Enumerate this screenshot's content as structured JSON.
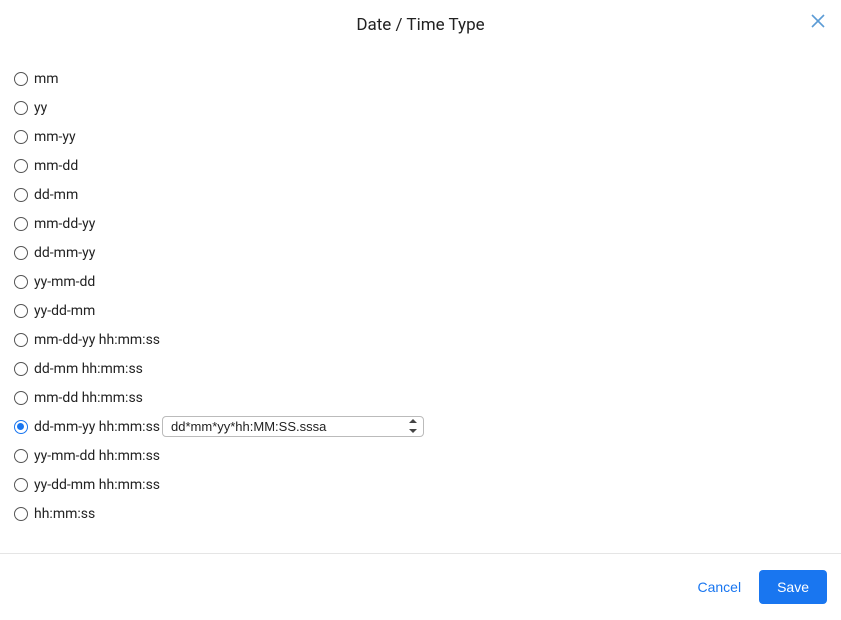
{
  "header": {
    "title": "Date / Time Type"
  },
  "options": [
    {
      "label": "mm",
      "checked": false
    },
    {
      "label": "yy",
      "checked": false
    },
    {
      "label": "mm-yy",
      "checked": false
    },
    {
      "label": "mm-dd",
      "checked": false
    },
    {
      "label": "dd-mm",
      "checked": false
    },
    {
      "label": "mm-dd-yy",
      "checked": false
    },
    {
      "label": "dd-mm-yy",
      "checked": false
    },
    {
      "label": "yy-mm-dd",
      "checked": false
    },
    {
      "label": "yy-dd-mm",
      "checked": false
    },
    {
      "label": "mm-dd-yy hh:mm:ss",
      "checked": false
    },
    {
      "label": "dd-mm hh:mm:ss",
      "checked": false
    },
    {
      "label": "mm-dd hh:mm:ss",
      "checked": false
    },
    {
      "label": "dd-mm-yy hh:mm:ss",
      "checked": true
    },
    {
      "label": "yy-mm-dd hh:mm:ss",
      "checked": false
    },
    {
      "label": "yy-dd-mm hh:mm:ss",
      "checked": false
    },
    {
      "label": "hh:mm:ss",
      "checked": false
    }
  ],
  "format_select": {
    "value": "dd*mm*yy*hh:MM:SS.sssa"
  },
  "footer": {
    "cancel": "Cancel",
    "save": "Save"
  }
}
